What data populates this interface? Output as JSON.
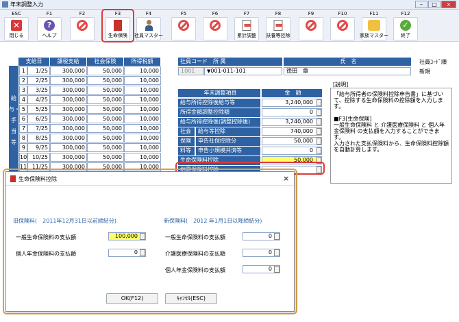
{
  "window": {
    "title": "年末調整入力",
    "min": "–",
    "max": "□",
    "close": "×"
  },
  "toolbar": [
    {
      "fkey": "ESC",
      "label": "閉じる",
      "icon": "close-icon"
    },
    {
      "fkey": "F1",
      "label": "ヘルプ",
      "icon": "help-icon"
    },
    {
      "fkey": "F2",
      "label": "",
      "icon": "prohibited-icon"
    },
    {
      "fkey": "F3",
      "label": "生命保険",
      "icon": "book-icon"
    },
    {
      "fkey": "F4",
      "label": "社員マスター",
      "icon": "person-icon"
    },
    {
      "fkey": "F5",
      "label": "",
      "icon": "prohibited-icon"
    },
    {
      "fkey": "F6",
      "label": "",
      "icon": "prohibited-icon"
    },
    {
      "fkey": "F7",
      "label": "累計調整",
      "icon": "document-icon"
    },
    {
      "fkey": "F8",
      "label": "扶養等控除",
      "icon": "document-icon"
    },
    {
      "fkey": "F9",
      "label": "",
      "icon": "prohibited-icon"
    },
    {
      "fkey": "F10",
      "label": "",
      "icon": "prohibited-icon"
    },
    {
      "fkey": "F11",
      "label": "家族マスター",
      "icon": "family-icon"
    },
    {
      "fkey": "F12",
      "label": "終了",
      "icon": "check-icon"
    }
  ],
  "pay_table": {
    "headers": [
      "支給日",
      "課税支給",
      "社会保険",
      "所得税額"
    ],
    "side_label": "給与・手当等",
    "rows": [
      {
        "no": "1",
        "date": "1/25",
        "taxable": "300,000",
        "social": "50,000",
        "tax": "10,000"
      },
      {
        "no": "2",
        "date": "2/25",
        "taxable": "300,000",
        "social": "50,000",
        "tax": "10,000"
      },
      {
        "no": "3",
        "date": "3/25",
        "taxable": "300,000",
        "social": "50,000",
        "tax": "10,000"
      },
      {
        "no": "4",
        "date": "4/25",
        "taxable": "300,000",
        "social": "50,000",
        "tax": "10,000"
      },
      {
        "no": "5",
        "date": "5/25",
        "taxable": "300,000",
        "social": "50,000",
        "tax": "10,000"
      },
      {
        "no": "6",
        "date": "6/25",
        "taxable": "300,000",
        "social": "50,000",
        "tax": "10,000"
      },
      {
        "no": "7",
        "date": "7/25",
        "taxable": "300,000",
        "social": "50,000",
        "tax": "10,000"
      },
      {
        "no": "8",
        "date": "8/25",
        "taxable": "300,000",
        "social": "50,000",
        "tax": "10,000"
      },
      {
        "no": "9",
        "date": "9/25",
        "taxable": "300,000",
        "social": "50,000",
        "tax": "10,000"
      },
      {
        "no": "10",
        "date": "10/25",
        "taxable": "300,000",
        "social": "50,000",
        "tax": "10,000"
      },
      {
        "no": "11",
        "date": "11/25",
        "taxable": "300,000",
        "social": "50,000",
        "tax": "10,000"
      }
    ]
  },
  "employee": {
    "code_label": "社員コード",
    "dept_label": "所 属",
    "name_label": "氏　名",
    "code": "1001",
    "dept": "001-011-101",
    "name": "徳田　章",
    "order_label": "社員ｺｰﾄﾞ順",
    "status": "新規"
  },
  "adjust": {
    "item_header": "年末調整項目",
    "amount_header": "金　額",
    "rows": [
      {
        "label": "給与所得控除後給与等",
        "value": "3,240,000"
      },
      {
        "label": "所得金額調整控除額",
        "value": "0"
      },
      {
        "label": "給与所得控除後(調整控除後)",
        "value": "3,240,000"
      },
      {
        "group": "社会",
        "label": "給与等控除",
        "value": "740,000"
      },
      {
        "group": "保険",
        "label": "申告社保控除分",
        "value": "50,000"
      },
      {
        "group": "料等",
        "label": "申告小規模共済等",
        "value": "0"
      },
      {
        "label": "生命保険料控除",
        "value": "50,000"
      },
      {
        "label": "地震保険料控除",
        "value": ""
      }
    ]
  },
  "explain": {
    "title": "[説明]",
    "text": "「給与所得者の保険料控除申告書」に基づいて、控除する生命保険料の控除額を入力します。\n\n■F3[生命保険]\n一般生命保険料 と 介護医療保険料 と 個人年金保険料 の支払額を入力することができます。\n入力された支払保険料から、生命保険料控除額を自動計算します。"
  },
  "dialog": {
    "title": "生命保険料控除",
    "close": "×",
    "old_header": "旧保険料(　2011年12月31日以前締結分)",
    "new_header": "新保険料(　2012 年1月1日以降締結分)",
    "old_rows": [
      {
        "label": "一般生命保険料の支払額",
        "value": "100,000"
      },
      {
        "label": "個人年金保険料の支払額",
        "value": "0"
      }
    ],
    "new_rows": [
      {
        "label": "一般生命保険料の支払額",
        "value": "0"
      },
      {
        "label": "介護医療保険料の支払額",
        "value": "0"
      },
      {
        "label": "個人年金保険料の支払額",
        "value": "0"
      }
    ],
    "ok": "OK(F12)",
    "cancel": "ｷｬﾝｾﾙ(ESC)"
  }
}
